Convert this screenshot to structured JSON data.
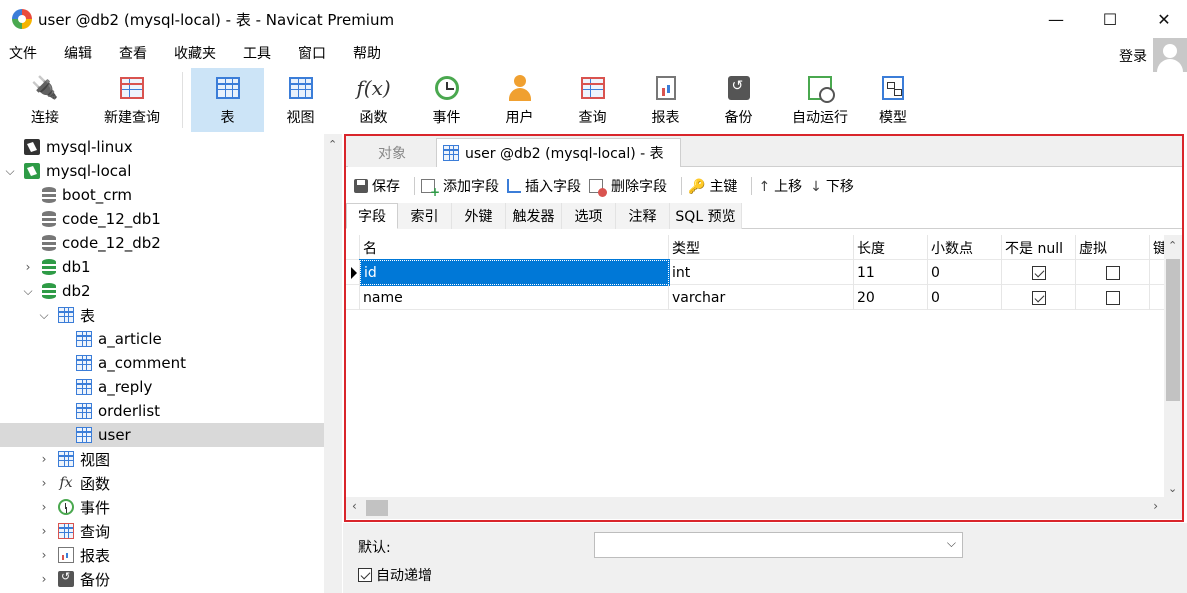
{
  "window": {
    "title": "user @db2 (mysql-local) - 表 - Navicat Premium",
    "controls": {
      "minimize": "—",
      "maximize": "☐",
      "close": "✕"
    }
  },
  "menu": [
    "文件",
    "编辑",
    "查看",
    "收藏夹",
    "工具",
    "窗口",
    "帮助"
  ],
  "account": {
    "login": "登录"
  },
  "toolbar": {
    "connect": "连接",
    "new_query": "新建查询",
    "table": "表",
    "view": "视图",
    "function": "函数",
    "event": "事件",
    "user": "用户",
    "query": "查询",
    "report": "报表",
    "backup": "备份",
    "auto_run": "自动运行",
    "model": "模型",
    "active": "表"
  },
  "sidebar": {
    "items": [
      {
        "label": "mysql-linux",
        "icon": "connection-icon"
      },
      {
        "label": "mysql-local",
        "icon": "connection-icon",
        "expanded": true
      },
      {
        "label": "boot_crm",
        "icon": "database-icon"
      },
      {
        "label": "code_12_db1",
        "icon": "database-icon"
      },
      {
        "label": "code_12_db2",
        "icon": "database-icon"
      },
      {
        "label": "db1",
        "icon": "database-icon"
      },
      {
        "label": "db2",
        "icon": "database-icon",
        "expanded": true
      },
      {
        "label": "表",
        "icon": "table-icon",
        "expanded": true
      },
      {
        "label": "a_article",
        "icon": "table-icon"
      },
      {
        "label": "a_comment",
        "icon": "table-icon"
      },
      {
        "label": "a_reply",
        "icon": "table-icon"
      },
      {
        "label": "orderlist",
        "icon": "table-icon"
      },
      {
        "label": "user",
        "icon": "table-icon",
        "selected": true
      },
      {
        "label": "视图",
        "icon": "view-icon"
      },
      {
        "label": "函数",
        "icon": "function-icon"
      },
      {
        "label": "事件",
        "icon": "event-icon"
      },
      {
        "label": "查询",
        "icon": "query-icon"
      },
      {
        "label": "报表",
        "icon": "report-icon"
      },
      {
        "label": "备份",
        "icon": "backup-icon"
      }
    ]
  },
  "tabs": {
    "objects": "对象",
    "designer": "user @db2 (mysql-local) - 表"
  },
  "edit_toolbar": {
    "save": "保存",
    "add_field": "添加字段",
    "insert_field": "插入字段",
    "delete_field": "删除字段",
    "primary_key": "主键",
    "move_up": "上移",
    "move_down": "下移"
  },
  "subtabs": [
    "字段",
    "索引",
    "外键",
    "触发器",
    "选项",
    "注释",
    "SQL 预览"
  ],
  "fields_table": {
    "columns": [
      "名",
      "类型",
      "长度",
      "小数点",
      "不是 null",
      "虚拟",
      "键"
    ],
    "rows": [
      {
        "name": "id",
        "type": "int",
        "length": "11",
        "decimals": "0",
        "not_null": true,
        "virtual": false
      },
      {
        "name": "name",
        "type": "varchar",
        "length": "20",
        "decimals": "0",
        "not_null": true,
        "virtual": false
      }
    ]
  },
  "properties": {
    "default_label": "默认:",
    "default_value": "",
    "auto_increment_label": "自动递增",
    "auto_increment": true
  },
  "colors": {
    "accent": "#0078d7",
    "highlight_box": "#d9252b",
    "active_toolbar": "#cce4f7"
  }
}
